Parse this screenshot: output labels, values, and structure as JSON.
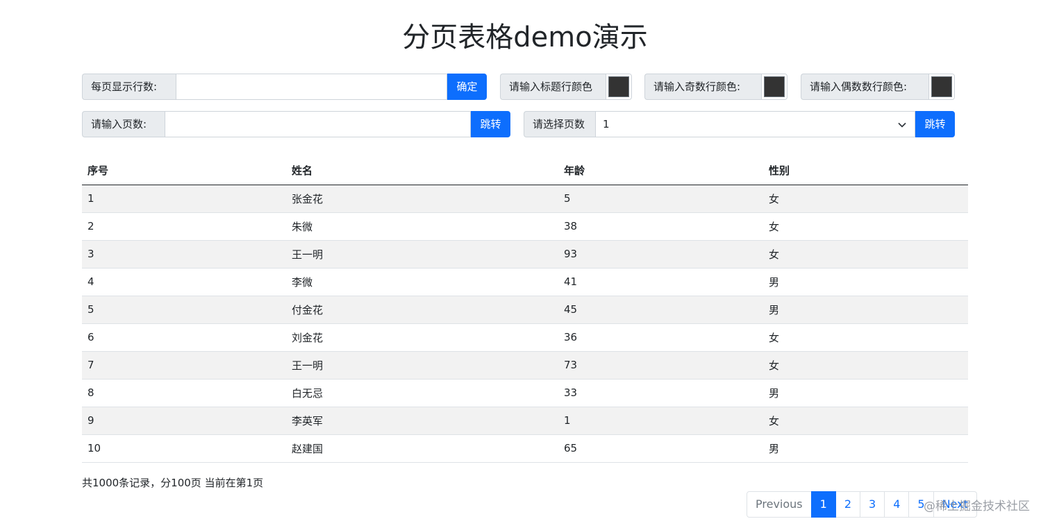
{
  "page": {
    "title": "分页表格demo演示"
  },
  "controls": {
    "rows_per_page_label": "每页显示行数:",
    "rows_per_page_value": "",
    "confirm_button": "确定",
    "header_color_label": "请输入标题行颜色",
    "header_color_value": "#333333",
    "odd_color_label": "请输入奇数行颜色:",
    "odd_color_value": "#333333",
    "even_color_label": "请输入偶数数行颜色:",
    "even_color_value": "#333333",
    "page_input_label": "请输入页数:",
    "page_input_value": "",
    "jump_button_1": "跳转",
    "page_select_label": "请选择页数",
    "page_select_value": "1",
    "jump_button_2": "跳转"
  },
  "table": {
    "columns": [
      "序号",
      "姓名",
      "年龄",
      "性别"
    ],
    "rows": [
      [
        "1",
        "张金花",
        "5",
        "女"
      ],
      [
        "2",
        "朱微",
        "38",
        "女"
      ],
      [
        "3",
        "王一明",
        "93",
        "女"
      ],
      [
        "4",
        "李微",
        "41",
        "男"
      ],
      [
        "5",
        "付金花",
        "45",
        "男"
      ],
      [
        "6",
        "刘金花",
        "36",
        "女"
      ],
      [
        "7",
        "王一明",
        "73",
        "女"
      ],
      [
        "8",
        "白无忌",
        "33",
        "男"
      ],
      [
        "9",
        "李英军",
        "1",
        "女"
      ],
      [
        "10",
        "赵建国",
        "65",
        "男"
      ]
    ]
  },
  "summary": "共1000条记录，分100页 当前在第1页",
  "pagination": {
    "previous": "Previous",
    "pages": [
      "1",
      "2",
      "3",
      "4",
      "5"
    ],
    "active": "1",
    "next": "Next"
  },
  "watermark": "@稀土掘金技术社区",
  "colors": {
    "primary": "#0d6efd",
    "odd_row": "#f2f2f2",
    "label_bg": "#e9ecef"
  }
}
